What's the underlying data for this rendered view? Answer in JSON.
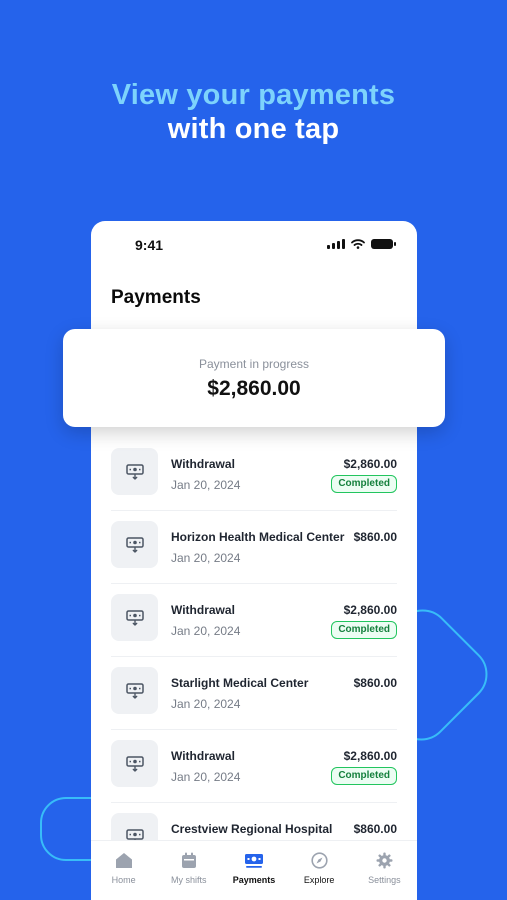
{
  "headline": {
    "line1": "View your payments",
    "line2": "with one tap"
  },
  "status_bar": {
    "time": "9:41"
  },
  "page": {
    "title": "Payments"
  },
  "progress": {
    "label": "Payment in progress",
    "amount": "$2,860.00"
  },
  "transactions": [
    {
      "name": "Withdrawal",
      "date": "Jan 20, 2024",
      "amount": "$2,860.00",
      "status": "Completed"
    },
    {
      "name": "Horizon Health Medical Center",
      "date": "Jan 20, 2024",
      "amount": "$860.00",
      "status": ""
    },
    {
      "name": "Withdrawal",
      "date": "Jan 20, 2024",
      "amount": "$2,860.00",
      "status": "Completed"
    },
    {
      "name": "Starlight Medical Center",
      "date": "Jan 20, 2024",
      "amount": "$860.00",
      "status": ""
    },
    {
      "name": "Withdrawal",
      "date": "Jan 20, 2024",
      "amount": "$2,860.00",
      "status": "Completed"
    },
    {
      "name": "Crestview Regional Hospital",
      "date": "",
      "amount": "$860.00",
      "status": ""
    }
  ],
  "tabs": [
    {
      "label": "Home",
      "icon": "home-icon"
    },
    {
      "label": "My shifts",
      "icon": "calendar-icon"
    },
    {
      "label": "Payments",
      "icon": "payments-icon"
    },
    {
      "label": "Explore",
      "icon": "compass-icon"
    },
    {
      "label": "Settings",
      "icon": "gear-icon"
    }
  ],
  "colors": {
    "background": "#2563EB",
    "accent_light": "#7DD3FC",
    "badge_green": "#22C55E"
  }
}
